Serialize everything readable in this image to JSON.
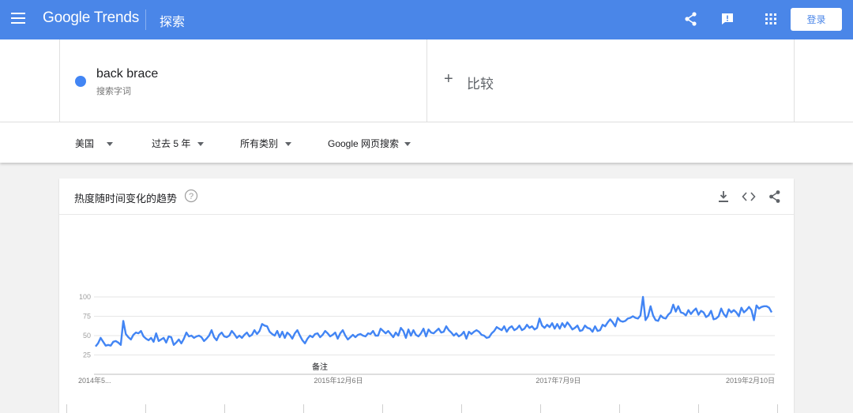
{
  "header": {
    "brand_google": "Google",
    "brand_trends": "Trends",
    "page_name": "探索",
    "login_label": "登录",
    "icons": [
      "menu-icon",
      "share-icon",
      "feedback-icon",
      "apps-icon"
    ],
    "bar_color": "#4a86e8"
  },
  "search_term": {
    "name": "back brace",
    "type": "搜索字词",
    "dot_color": "#4285f4"
  },
  "compare": {
    "label": "比较"
  },
  "filters": [
    {
      "label": "美国"
    },
    {
      "label": "过去 5 年"
    },
    {
      "label": "所有类别"
    },
    {
      "label": "Google 网页搜索"
    }
  ],
  "chart_card": {
    "title": "热度随时间变化的趋势",
    "note": "备注",
    "icons": [
      "help-icon",
      "download-icon",
      "embed-icon",
      "share-icon"
    ]
  },
  "chart_data": {
    "type": "line",
    "title": "热度随时间变化的趋势",
    "xlabel": "",
    "ylabel": "",
    "ylim": [
      0,
      100
    ],
    "yticks": [
      25,
      50,
      75,
      100
    ],
    "ytick_labels": [
      "25",
      "50",
      "75",
      "100"
    ],
    "xtick_labels": [
      "2014年5...",
      "2015年12月6日",
      "2017年7月9日",
      "2019年2月10日"
    ],
    "xtick_positions": [
      0,
      0.359,
      0.682,
      1.0
    ],
    "grid": true,
    "series": [
      {
        "name": "back brace",
        "color": "#4285f4",
        "values": [
          36,
          40,
          47,
          42,
          37,
          38,
          37,
          42,
          43,
          41,
          38,
          69,
          52,
          48,
          45,
          51,
          54,
          53,
          56,
          49,
          46,
          44,
          47,
          42,
          53,
          43,
          45,
          47,
          41,
          49,
          48,
          38,
          41,
          45,
          40,
          46,
          54,
          49,
          50,
          47,
          49,
          50,
          48,
          43,
          46,
          50,
          57,
          48,
          44,
          51,
          54,
          49,
          48,
          50,
          56,
          52,
          47,
          50,
          47,
          51,
          54,
          49,
          51,
          57,
          52,
          56,
          65,
          63,
          62,
          55,
          52,
          50,
          56,
          48,
          55,
          47,
          54,
          51,
          46,
          53,
          57,
          50,
          44,
          40,
          46,
          50,
          48,
          52,
          53,
          48,
          51,
          56,
          53,
          49,
          51,
          54,
          46,
          53,
          57,
          50,
          45,
          48,
          51,
          48,
          51,
          52,
          50,
          49,
          53,
          52,
          56,
          50,
          50,
          59,
          56,
          53,
          56,
          52,
          48,
          54,
          50,
          60,
          56,
          47,
          58,
          50,
          57,
          51,
          49,
          53,
          59,
          49,
          58,
          54,
          53,
          56,
          59,
          54,
          55,
          62,
          57,
          54,
          50,
          53,
          49,
          51,
          55,
          46,
          55,
          52,
          55,
          57,
          55,
          51,
          50,
          47,
          48,
          53,
          56,
          61,
          59,
          57,
          62,
          55,
          60,
          62,
          57,
          59,
          63,
          57,
          59,
          64,
          60,
          62,
          58,
          60,
          72,
          63,
          60,
          64,
          61,
          66,
          59,
          65,
          59,
          66,
          61,
          67,
          63,
          58,
          60,
          63,
          56,
          57,
          63,
          60,
          59,
          55,
          62,
          56,
          57,
          64,
          62,
          67,
          71,
          67,
          62,
          73,
          69,
          68,
          69,
          72,
          73,
          75,
          73,
          72,
          76,
          100,
          70,
          75,
          88,
          76,
          70,
          69,
          76,
          73,
          72,
          77,
          80,
          90,
          81,
          88,
          80,
          79,
          76,
          83,
          78,
          82,
          85,
          77,
          82,
          80,
          74,
          76,
          82,
          71,
          72,
          75,
          85,
          78,
          74,
          84,
          80,
          83,
          80,
          75,
          86,
          80,
          83,
          87,
          83,
          70,
          89,
          85,
          87,
          88,
          88,
          86,
          80
        ]
      }
    ]
  }
}
